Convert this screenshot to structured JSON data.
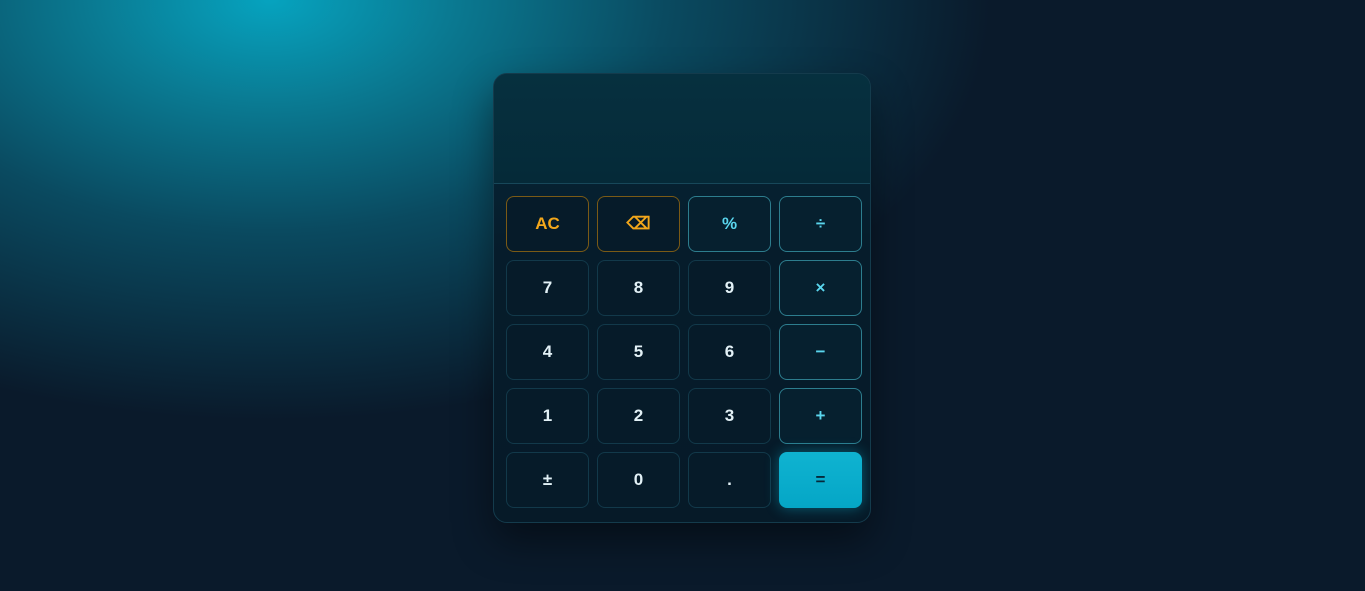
{
  "display": {
    "expression": "",
    "value": ""
  },
  "keys": {
    "ac": "AC",
    "backspace": "⌫",
    "percent": "%",
    "divide": "÷",
    "seven": "7",
    "eight": "8",
    "nine": "9",
    "multiply": "×",
    "four": "4",
    "five": "5",
    "six": "6",
    "minus": "−",
    "one": "1",
    "two": "2",
    "three": "3",
    "plus": "+",
    "sign": "±",
    "zero": "0",
    "decimal": ".",
    "equals": "="
  },
  "colors": {
    "accent": "#06a6c6",
    "clear": "#f2a71b",
    "operator": "#5ad6ee",
    "background": "#0a1a2b"
  }
}
